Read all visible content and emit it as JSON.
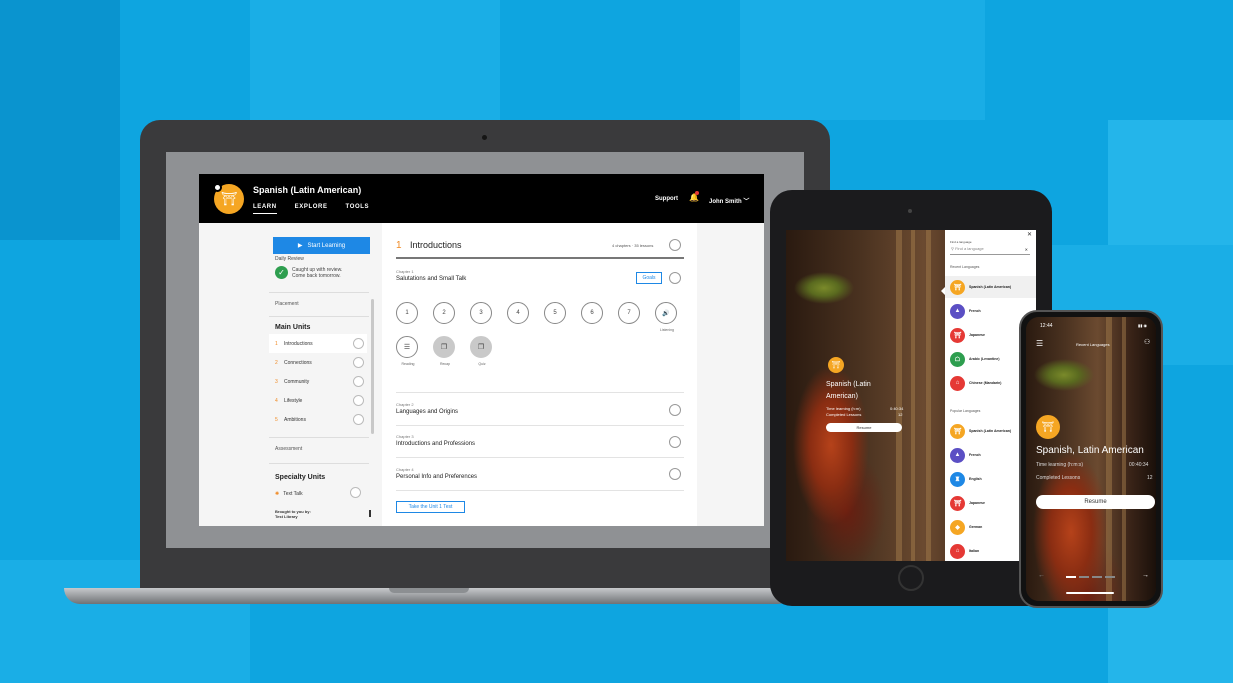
{
  "laptop_app": {
    "title": "Spanish (Latin American)",
    "nav": [
      "LEARN",
      "EXPLORE",
      "TOOLS"
    ],
    "support": "Support",
    "user": "John Smith",
    "sidebar": {
      "start_button": "Start Learning",
      "daily_review_label": "Daily Review",
      "daily_review_text": "Caught up with review. Come back tomorrow.",
      "placement": "Placement",
      "main_units_heading": "Main Units",
      "units": [
        {
          "num": "1",
          "label": "Introductions"
        },
        {
          "num": "2",
          "label": "Connections"
        },
        {
          "num": "3",
          "label": "Community"
        },
        {
          "num": "4",
          "label": "Lifestyle"
        },
        {
          "num": "5",
          "label": "Ambitions"
        }
      ],
      "assessment": "Assessment",
      "specialty_heading": "Specialty Units",
      "text_talk": "Text Talk",
      "brought_by": "Brought to you by:",
      "library": "Test Library"
    },
    "main": {
      "section_num": "1",
      "section_title": "Introductions",
      "section_count": "4 chapters · 35 lessons",
      "goals": "Goals",
      "chapters": [
        {
          "label": "Chapter 1",
          "name": "Salutations and Small Talk"
        },
        {
          "label": "Chapter 2",
          "name": "Languages and Origins"
        },
        {
          "label": "Chapter 3",
          "name": "Introductions and Professions"
        },
        {
          "label": "Chapter 4",
          "name": "Personal Info and Preferences"
        }
      ],
      "lessons": [
        "1",
        "2",
        "3",
        "4",
        "5",
        "6",
        "7"
      ],
      "listening": "Listening",
      "tools": [
        "Reading",
        "Recap",
        "Quiz"
      ],
      "unit_test": "Take the Unit 1 Test"
    }
  },
  "tablet": {
    "language": "Spanish (Latin American)",
    "time_label": "Time learning (h:m)",
    "time_value": "0:40:34",
    "completed_label": "Completed Lessons",
    "completed_value": "12",
    "resume": "Resume",
    "panel": {
      "find_label": "Find a language",
      "search_placeholder": "Find a language",
      "recent_heading": "Recent Languages",
      "recent": [
        {
          "name": "Spanish (Latin American)",
          "color": "#f5a623"
        },
        {
          "name": "French",
          "color": "#5b4fc4"
        },
        {
          "name": "Japanese",
          "color": "#e53935"
        },
        {
          "name": "Arabic (Levantine)",
          "color": "#2e9e4f"
        },
        {
          "name": "Chinese (Mandarin)",
          "color": "#e53935"
        }
      ],
      "popular_heading": "Popular Languages",
      "popular": [
        {
          "name": "Spanish (Latin American)",
          "color": "#f5a623"
        },
        {
          "name": "French",
          "color": "#5b4fc4"
        },
        {
          "name": "English",
          "color": "#1e88e5"
        },
        {
          "name": "Japanese",
          "color": "#e53935"
        },
        {
          "name": "German",
          "color": "#f5a623"
        },
        {
          "name": "Italian",
          "color": "#e53935"
        }
      ]
    }
  },
  "phone": {
    "clock": "12:44",
    "recent_label": "Recent Languages",
    "language": "Spanish, Latin American",
    "time_label": "Time learning (h:m:s)",
    "time_value": "00:40:34",
    "completed_label": "Completed Lessons",
    "completed_value": "12",
    "resume": "Resume"
  }
}
